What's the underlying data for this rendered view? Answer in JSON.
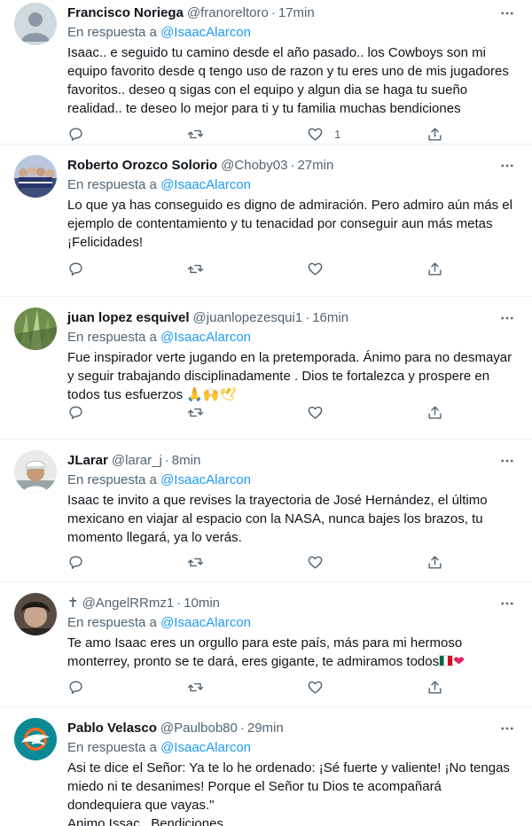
{
  "reply_prefix": "En respuesta a",
  "dot": "·",
  "tweets": [
    {
      "name": "Francisco Noriega",
      "handle": "@franoreltoro",
      "time": "17min",
      "reply_to": "@IsaacAlarcon",
      "text": "Isaac.. e seguido tu camino desde el año pasado.. los Cowboys son mi equipo favorito desde q tengo uso de razon y tu eres uno de mis jugadores favoritos.. deseo q sigas con el equipo y algun dia se haga tu sueño realidad.. te deseo lo mejor para ti y tu familia muchas bendiciones",
      "likes": "1"
    },
    {
      "name": "Roberto Orozco Solorio",
      "handle": "@Choby03",
      "time": "27min",
      "reply_to": "@IsaacAlarcon",
      "text": "Lo que ya has conseguido es digno de admiración.  Pero admiro aún más el ejemplo de contentamiento y tu tenacidad por conseguir aun más metas ¡Felicidades!",
      "likes": ""
    },
    {
      "name": "juan lopez esquivel",
      "handle": "@juanlopezesqui1",
      "time": "16min",
      "reply_to": "@IsaacAlarcon",
      "text": "Fue inspirador verte jugando en la pretemporada. Ánimo para no desmayar y seguir trabajando disciplinadamente . Dios te fortalezca y prospere en todos tus esfuerzos",
      "emoji": "🙏🙌🕊",
      "likes": ""
    },
    {
      "name": "JLarar",
      "handle": "@larar_j",
      "time": "8min",
      "reply_to": "@IsaacAlarcon",
      "text": "Isaac te invito a que revises la trayectoria de José Hernández, el último mexicano en viajar al espacio con la NASA, nunca bajes los brazos, tu momento llegará, ya lo verás.",
      "likes": ""
    },
    {
      "name": "✝",
      "handle": "@AngelRRmz1",
      "time": "10min",
      "reply_to": "@IsaacAlarcon",
      "text": "Te amo Isaac eres un orgullo para este país, más para mi hermoso monterrey, pronto se te dará, eres gigante, te admiramos todos",
      "emoji": "❤",
      "likes": ""
    },
    {
      "name": "Pablo Velasco",
      "handle": "@Paulbob80",
      "time": "29min",
      "reply_to": "@IsaacAlarcon",
      "text": "Asi te dice el Señor: Ya te lo he ordenado:  ¡Sé fuerte y valiente!  ¡No tengas miedo ni te desanimes!  Porque el Señor tu Dios te acompañará dondequiera que vayas.\"\nAnimo Issac...Bendiciones",
      "likes": ""
    }
  ],
  "icons": {
    "reply": "reply-icon",
    "retweet": "retweet-icon",
    "like": "heart-icon",
    "share": "share-icon",
    "more": "more-icon"
  },
  "colors": {
    "text": "#0f1419",
    "secondary": "#536471",
    "link": "#1d9bf0",
    "border": "#eff3f4"
  }
}
